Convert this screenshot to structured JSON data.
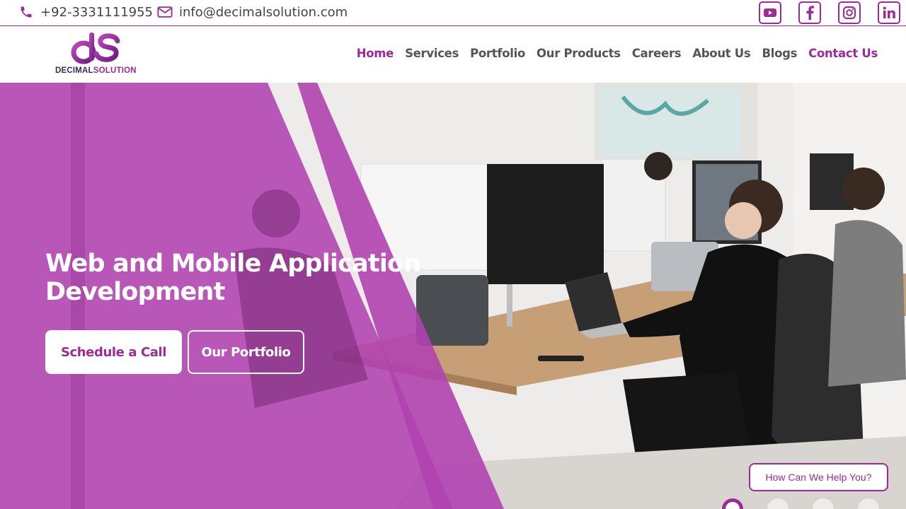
{
  "topbar": {
    "phone": "+92-3331111955",
    "email": "info@decimalsolution.com",
    "socials": [
      "youtube-icon",
      "facebook-icon",
      "instagram-icon",
      "linkedin-icon"
    ]
  },
  "brand": {
    "name_part1": "DECIMAL",
    "name_part2": "SOLUTION",
    "accent_color": "#9c2a98"
  },
  "nav": {
    "items": [
      "Home",
      "Services",
      "Portfolio",
      "Our Products",
      "Careers",
      "About Us",
      "Blogs",
      "Contact Us"
    ],
    "active": "Home"
  },
  "hero": {
    "title": "Web and Mobile Application Development",
    "primary_button": "Schedule a Call",
    "secondary_button": "Our Portfolio",
    "slides_total": 4,
    "active_slide": 1
  },
  "help_widget": {
    "label": "How Can We Help You?"
  }
}
